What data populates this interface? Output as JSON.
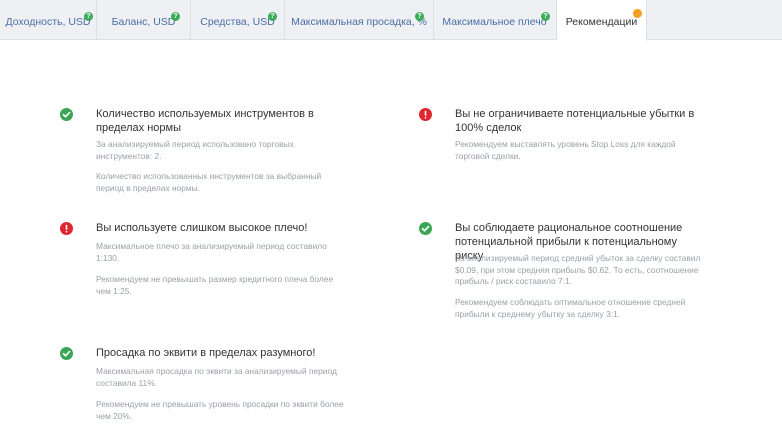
{
  "tabs": [
    {
      "label": "Доходность, USD",
      "help": "?"
    },
    {
      "label": "Баланс, USD",
      "help": "?"
    },
    {
      "label": "Средства, USD",
      "help": "?"
    },
    {
      "label": "Максимальная просадка, %",
      "help": "?"
    },
    {
      "label": "Максимальное плечо",
      "help": "?"
    },
    {
      "label": "Рекомендации"
    }
  ],
  "recommendations": [
    {
      "status": "ok",
      "title": "Количество используемых инструментов в пределах нормы",
      "p1": "За анализируемый период использовано торговых инструментов: 2.",
      "p2": "Количество использованных инструментов за выбранный период в пределах нормы."
    },
    {
      "status": "warn",
      "title": "Вы не ограничиваете потенциальные убытки в 100% сделок",
      "p1": "Рекомендуем выставлять уровень Stop Loss для каждой торговой сделки."
    },
    {
      "status": "warn",
      "title": "Вы используете слишком высокое плечо!",
      "p1": "Максимальное плечо за анализируемый период составило 1:130.",
      "p2": "Рекомендуем не превышать размер кредитного плеча более чем 1:25."
    },
    {
      "status": "ok",
      "title": "Вы соблюдаете рациональное соотношение потенциальной прибыли к потенциальному риску",
      "p1": "За анализируемый период средний убыток за сделку составил $0.09, при этом средняя прибыль $0.62. То есть, соотношение прибыль / риск составило 7:1.",
      "p2": "Рекомендуем соблюдать оптимальное отношение средней прибыли к среднему убытку за сделку 3:1."
    },
    {
      "status": "ok",
      "title": "Просадка по эквити в пределах разумного!",
      "p1": "Максимальная просадка по эквити за анализируемый период составила 11%.",
      "p2": "Рекомендуем не превышать уровень просадки по эквити более чем 20%."
    }
  ],
  "colors": {
    "ok": "#3aa655",
    "warn": "#e0262e",
    "tab_text": "#4a6fa5",
    "notice_dot": "#f5a023"
  }
}
